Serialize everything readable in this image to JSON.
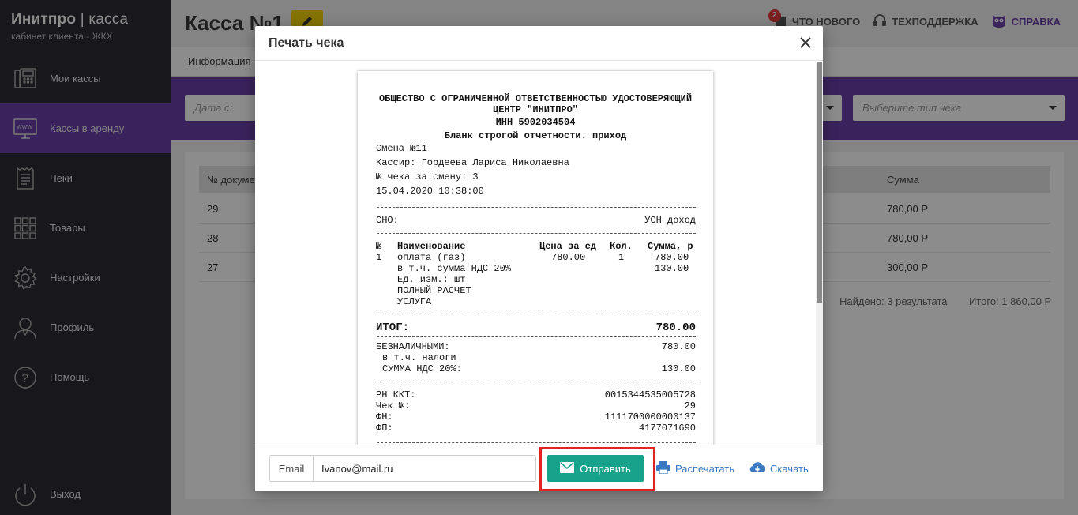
{
  "sidebar": {
    "brand_title": "Инитпро",
    "brand_sep": "|",
    "brand_product": "касса",
    "brand_subtitle": "кабинет клиента - ЖКХ",
    "items": [
      {
        "label": "Мои кассы",
        "icon": "fax-register-icon"
      },
      {
        "label": "Кассы в аренду",
        "icon": "monitor-www-icon",
        "active": true
      },
      {
        "label": "Чеки",
        "icon": "receipt-icon"
      },
      {
        "label": "Товары",
        "icon": "grid-icon"
      },
      {
        "label": "Настройки",
        "icon": "gear-icon"
      },
      {
        "label": "Профиль",
        "icon": "user-icon"
      },
      {
        "label": "Помощь",
        "icon": "question-icon"
      }
    ],
    "logout_label": "Выход"
  },
  "header": {
    "title": "Касса №1",
    "notif_count": "2",
    "whats_new": "ЧТО НОВОГО",
    "support": "ТЕХПОДДЕРЖКА",
    "help": "СПРАВКА"
  },
  "tabs": {
    "info": "Информация"
  },
  "filters": {
    "date_from_placeholder": "Дата с:",
    "receipt_type_placeholder": "Выберите тип чека"
  },
  "table": {
    "col_doc": "№ докуме",
    "col_sum": "Сумма",
    "rows": [
      {
        "doc": "29",
        "sum": "780,00 Р"
      },
      {
        "doc": "28",
        "sum": "780,00 Р"
      },
      {
        "doc": "27",
        "sum": "300,00 Р"
      }
    ],
    "found": "Найдено: 3 результата",
    "total": "Итого: 1 860,00 Р"
  },
  "modal": {
    "title": "Печать чека",
    "receipt": {
      "org_line1": "ОБЩЕСТВО С ОГРАНИЧЕННОЙ ОТВЕТСТВЕННОСТЬЮ УДОСТОВЕРЯЮЩИЙ",
      "org_line2": "ЦЕНТР \"ИНИТПРО\"",
      "inn": "ИНН 5902034504",
      "form_type": "Бланк строгой отчетности. приход",
      "shift": "Смена №11",
      "cashier": "Кассир: Гордеева Лариса Николаевна",
      "check_in_shift": "№ чека за смену: 3",
      "datetime": "15.04.2020 10:38:00",
      "sno_label": "СНО:",
      "sno_value": "УСН доход",
      "cols": {
        "no": "№",
        "name": "Наименование",
        "price": "Цена за ед",
        "qty": "Кол.",
        "sum": "Сумма, р"
      },
      "item": {
        "no": "1",
        "name": "оплата (газ)",
        "price": "780.00",
        "qty": "1",
        "sum": "780.00",
        "vat_line": "в т.ч. сумма НДС 20%",
        "vat_sum": "130.00",
        "unit": "Ед. изм.: шт",
        "calc": "ПОЛНЫЙ РАСЧЕТ",
        "kind": "УСЛУГА"
      },
      "total_label": "ИТОГ:",
      "total_value": "780.00",
      "cashless_label": "БЕЗНАЛИЧНЫМИ:",
      "cashless_value": "780.00",
      "taxes_label": "в т.ч. налоги",
      "vat_label": "СУММА НДС 20%:",
      "vat_value": "130.00",
      "rn_label": "РН ККТ:",
      "rn_value": "0015344535005728",
      "check_label": "Чек №:",
      "check_value": "29",
      "fn_label": "ФН:",
      "fn_value": "1111700000000137",
      "fp_label": "ФП:",
      "fp_value": "4177071690"
    },
    "email_label": "Email",
    "email_value": "Ivanov@mail.ru",
    "send_label": "Отправить",
    "print_label": "Распечатать",
    "download_label": "Скачать"
  }
}
